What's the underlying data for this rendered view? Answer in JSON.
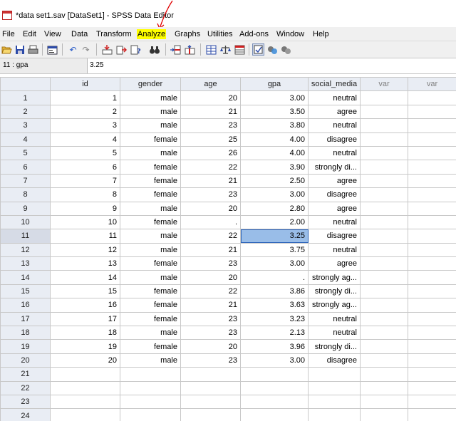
{
  "window": {
    "title": "*data set1.sav [DataSet1] - SPSS Data Editor"
  },
  "menu": [
    "File",
    "Edit",
    "View",
    "Data",
    "Transform",
    "Analyze",
    "Graphs",
    "Utilities",
    "Add-ons",
    "Window",
    "Help"
  ],
  "highlight_color": "#ffff00",
  "annotation_color": "#e00000",
  "toolbar_icons": [
    "open-icon",
    "save-icon",
    "print-icon",
    "dialog-recall-icon",
    "undo-icon",
    "redo-icon",
    "goto-case-icon",
    "goto-variable-icon",
    "variables-icon",
    "find-icon",
    "insert-cases-icon",
    "insert-variable-icon",
    "split-file-icon",
    "weight-cases-icon",
    "select-cases-icon",
    "value-labels-icon",
    "use-sets-icon",
    "show-all-variables-icon"
  ],
  "cell_editor": {
    "reference": "11 : gpa",
    "value": "3.25"
  },
  "columns": [
    "id",
    "gender",
    "age",
    "gpa",
    "social_media",
    "var",
    "var"
  ],
  "rows": [
    {
      "n": "1",
      "cells": [
        "1",
        "male",
        "20",
        "3.00",
        "neutral",
        "",
        ""
      ]
    },
    {
      "n": "2",
      "cells": [
        "2",
        "male",
        "21",
        "3.50",
        "agree",
        "",
        ""
      ]
    },
    {
      "n": "3",
      "cells": [
        "3",
        "male",
        "23",
        "3.80",
        "neutral",
        "",
        ""
      ]
    },
    {
      "n": "4",
      "cells": [
        "4",
        "female",
        "25",
        "4.00",
        "disagree",
        "",
        ""
      ]
    },
    {
      "n": "5",
      "cells": [
        "5",
        "male",
        "26",
        "4.00",
        "neutral",
        "",
        ""
      ]
    },
    {
      "n": "6",
      "cells": [
        "6",
        "female",
        "22",
        "3.90",
        "strongly di...",
        "",
        ""
      ]
    },
    {
      "n": "7",
      "cells": [
        "7",
        "female",
        "21",
        "2.50",
        "agree",
        "",
        ""
      ]
    },
    {
      "n": "8",
      "cells": [
        "8",
        "female",
        "23",
        "3.00",
        "disagree",
        "",
        ""
      ]
    },
    {
      "n": "9",
      "cells": [
        "9",
        "male",
        "20",
        "2.80",
        "agree",
        "",
        ""
      ]
    },
    {
      "n": "10",
      "cells": [
        "10",
        "female",
        ".",
        "2.00",
        "neutral",
        "",
        ""
      ]
    },
    {
      "n": "11",
      "cells": [
        "11",
        "male",
        "22",
        "3.25",
        "disagree",
        "",
        ""
      ]
    },
    {
      "n": "12",
      "cells": [
        "12",
        "male",
        "21",
        "3.75",
        "neutral",
        "",
        ""
      ]
    },
    {
      "n": "13",
      "cells": [
        "13",
        "female",
        "23",
        "3.00",
        "agree",
        "",
        ""
      ]
    },
    {
      "n": "14",
      "cells": [
        "14",
        "male",
        "20",
        ".",
        "strongly ag...",
        "",
        ""
      ]
    },
    {
      "n": "15",
      "cells": [
        "15",
        "female",
        "22",
        "3.86",
        "strongly di...",
        "",
        ""
      ]
    },
    {
      "n": "16",
      "cells": [
        "16",
        "female",
        "21",
        "3.63",
        "strongly ag...",
        "",
        ""
      ]
    },
    {
      "n": "17",
      "cells": [
        "17",
        "female",
        "23",
        "3.23",
        "neutral",
        "",
        ""
      ]
    },
    {
      "n": "18",
      "cells": [
        "18",
        "male",
        "23",
        "2.13",
        "neutral",
        "",
        ""
      ]
    },
    {
      "n": "19",
      "cells": [
        "19",
        "female",
        "20",
        "3.96",
        "strongly di...",
        "",
        ""
      ]
    },
    {
      "n": "20",
      "cells": [
        "20",
        "male",
        "23",
        "3.00",
        "disagree",
        "",
        ""
      ]
    },
    {
      "n": "21",
      "cells": [
        "",
        "",
        "",
        "",
        "",
        "",
        ""
      ]
    },
    {
      "n": "22",
      "cells": [
        "",
        "",
        "",
        "",
        "",
        "",
        ""
      ]
    },
    {
      "n": "23",
      "cells": [
        "",
        "",
        "",
        "",
        "",
        "",
        ""
      ]
    },
    {
      "n": "24",
      "cells": [
        "",
        "",
        "",
        "",
        "",
        "",
        ""
      ]
    }
  ],
  "selected_cell": {
    "row": "11",
    "column": "gpa"
  }
}
